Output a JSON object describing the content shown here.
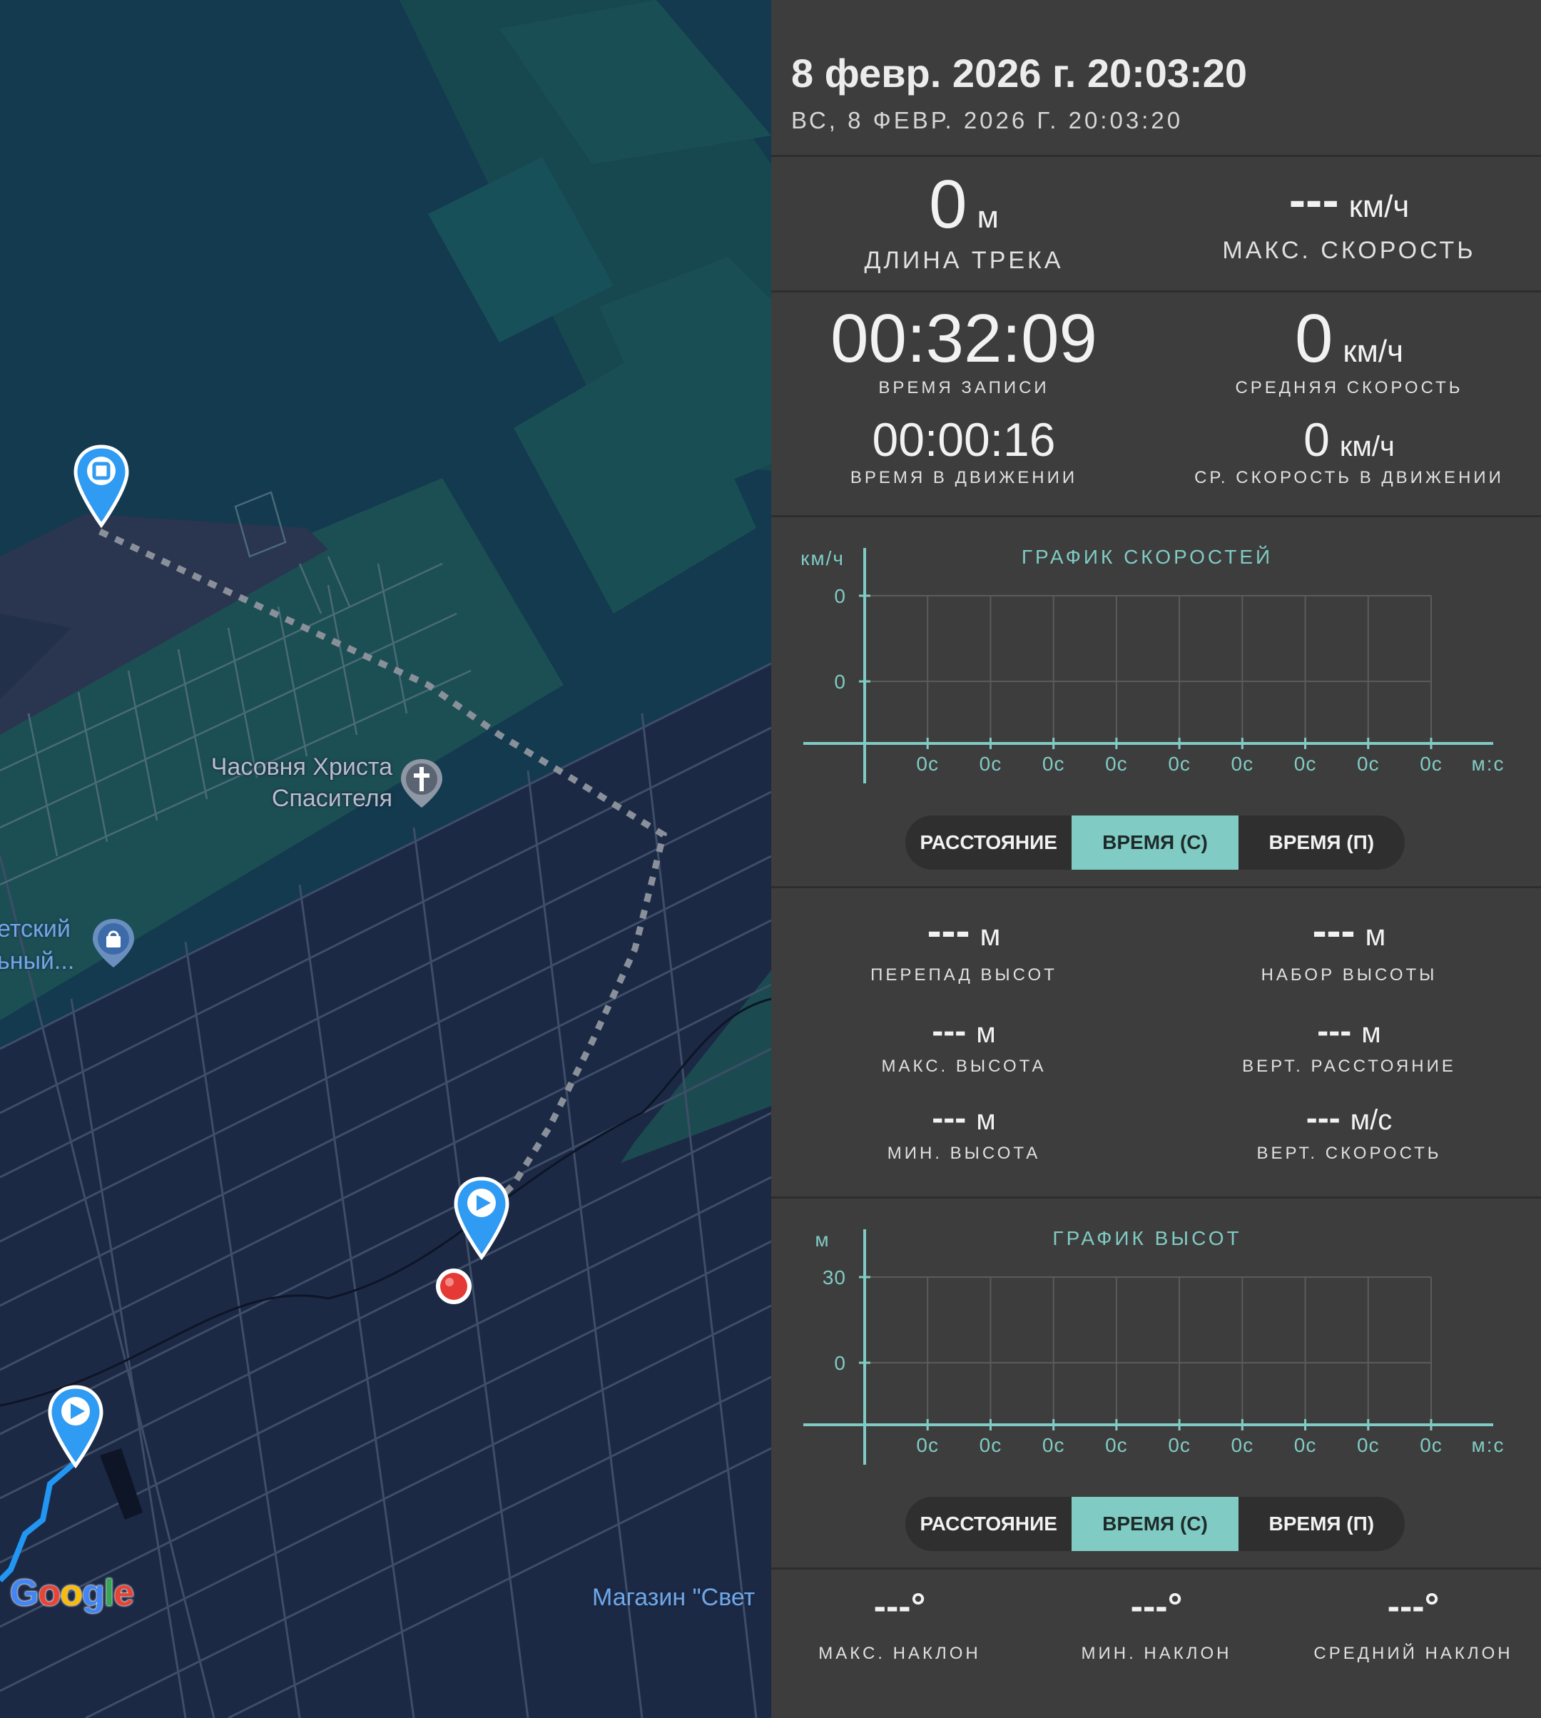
{
  "map": {
    "poi_chapel": "Часовня Христа\nСпасителя",
    "poi_left_1": "етский",
    "poi_left_2": "ьный...",
    "poi_shop": "Магазин \"Свет",
    "logo": "Google"
  },
  "header": {
    "date_primary": "8 февр. 2026 г. 20:03:20",
    "date_secondary": "ВС, 8 ФЕВР. 2026 Г. 20:03:20"
  },
  "stats": {
    "track_length": {
      "value": "0",
      "unit": "м",
      "label": "ДЛИНА ТРЕКА"
    },
    "max_speed": {
      "value": "---",
      "unit": "км/ч",
      "label": "МАКС. СКОРОСТЬ"
    },
    "record_time": {
      "value": "00:32:09",
      "label": "ВРЕМЯ ЗАПИСИ"
    },
    "avg_speed": {
      "value": "0",
      "unit": "км/ч",
      "label": "СРЕДНЯЯ СКОРОСТЬ"
    },
    "moving_time": {
      "value": "00:00:16",
      "label": "ВРЕМЯ В ДВИЖЕНИИ"
    },
    "avg_moving_speed": {
      "value": "0",
      "unit": "км/ч",
      "label": "СР. СКОРОСТЬ В ДВИЖЕНИИ"
    }
  },
  "speed_chart": {
    "title": "ГРАФИК СКОРОСТЕЙ",
    "y_unit": "км/ч",
    "x_unit": "м:с",
    "toggle": [
      "РАССТОЯНИЕ",
      "ВРЕМЯ (С)",
      "ВРЕМЯ (П)"
    ],
    "active_toggle": 1
  },
  "elevation": {
    "drop": {
      "value": "---",
      "unit": "м",
      "label": "ПЕРЕПАД ВЫСОТ"
    },
    "gain": {
      "value": "---",
      "unit": "м",
      "label": "НАБОР ВЫСОТЫ"
    },
    "max": {
      "value": "---",
      "unit": "м",
      "label": "МАКС. ВЫСОТА"
    },
    "vert_dist": {
      "value": "---",
      "unit": "м",
      "label": "ВЕРТ. РАССТОЯНИЕ"
    },
    "min": {
      "value": "---",
      "unit": "м",
      "label": "МИН. ВЫСОТА"
    },
    "vert_speed": {
      "value": "---",
      "unit": "м/с",
      "label": "ВЕРТ. СКОРОСТЬ"
    }
  },
  "elevation_chart": {
    "title": "ГРАФИК ВЫСОТ",
    "y_unit": "м",
    "x_unit": "м:с",
    "toggle": [
      "РАССТОЯНИЕ",
      "ВРЕМЯ (С)",
      "ВРЕМЯ (П)"
    ],
    "active_toggle": 1
  },
  "slope": {
    "max": {
      "value": "---°",
      "label": "МАКС. НАКЛОН"
    },
    "min": {
      "value": "---°",
      "label": "МИН. НАКЛОН"
    },
    "avg": {
      "value": "---°",
      "label": "СРЕДНИЙ НАКЛОН"
    }
  },
  "chart_data": [
    {
      "type": "line",
      "title": "ГРАФИК СКОРОСТЕЙ",
      "ylabel": "км/ч",
      "xlabel": "м:с",
      "y_ticks": [
        "0",
        "0"
      ],
      "x_ticks": [
        "0с",
        "0с",
        "0с",
        "0с",
        "0с",
        "0с",
        "0с",
        "0с",
        "0с"
      ],
      "series": [],
      "grid": true
    },
    {
      "type": "line",
      "title": "ГРАФИК ВЫСОТ",
      "ylabel": "м",
      "xlabel": "м:с",
      "y_ticks": [
        "30",
        "0"
      ],
      "x_ticks": [
        "0с",
        "0с",
        "0с",
        "0с",
        "0с",
        "0с",
        "0с",
        "0с",
        "0с"
      ],
      "series": [],
      "grid": true
    }
  ]
}
